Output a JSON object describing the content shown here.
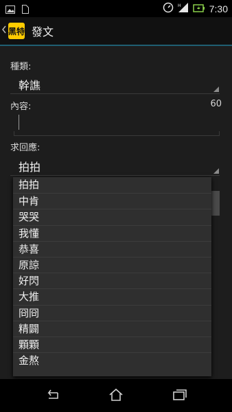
{
  "status": {
    "time": "7:30"
  },
  "app": {
    "logo_text": "黑特",
    "title": "發文"
  },
  "form": {
    "type_label": "種類:",
    "type_value": "幹譙",
    "content_label": "內容:",
    "content_counter": "60",
    "response_label": "求回應:",
    "response_value": "拍拍"
  },
  "dropdown": {
    "items": [
      "拍拍",
      "中肯",
      "哭哭",
      "我懂",
      "恭喜",
      "原諒",
      "好閃",
      "大推",
      "冏冏",
      "精闢",
      "顆顆",
      "金熬"
    ]
  }
}
